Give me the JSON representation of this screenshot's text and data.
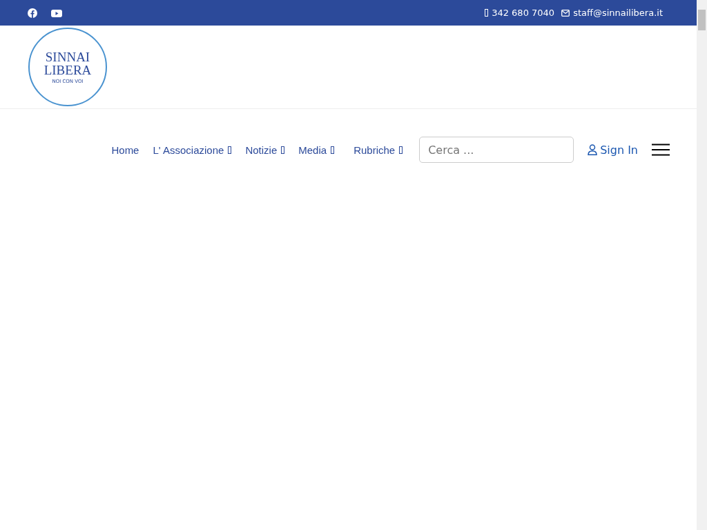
{
  "topbar": {
    "phone": "342 680 7040",
    "email": "staff@sinnailibera.it"
  },
  "logo": {
    "line_1": "SINNAI",
    "line_2": "LIBERA",
    "tagline": "NOI CON VOI"
  },
  "nav": {
    "items": [
      {
        "label": "Home",
        "has_submenu": false
      },
      {
        "label": "L' Associazione",
        "has_submenu": true
      },
      {
        "label": "Notizie",
        "has_submenu": true
      },
      {
        "label": "Media",
        "has_submenu": true
      },
      {
        "label": "Rubriche",
        "has_submenu": true
      }
    ],
    "search": {
      "placeholder": "Cerca ..."
    },
    "sign_in": "Sign In"
  }
}
